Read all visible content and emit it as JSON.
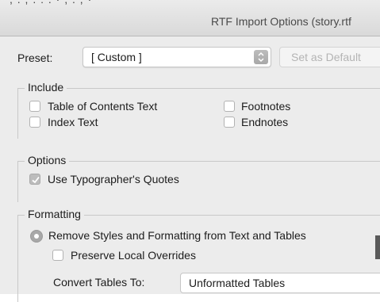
{
  "window": {
    "title": "RTF Import Options (story.rtf",
    "cut_text": ", . , . : . · , . , ·"
  },
  "preset": {
    "label": "Preset:",
    "value": "[ Custom ]",
    "set_default_label": "Set as Default",
    "set_default_enabled": false
  },
  "include": {
    "title": "Include",
    "items": [
      {
        "label": "Table of Contents Text",
        "checked": false
      },
      {
        "label": "Footnotes",
        "checked": false
      },
      {
        "label": "Index Text",
        "checked": false
      },
      {
        "label": "Endnotes",
        "checked": false
      }
    ]
  },
  "options": {
    "title": "Options",
    "typographers_quotes": {
      "label": "Use Typographer's Quotes",
      "checked": true
    }
  },
  "formatting": {
    "title": "Formatting",
    "remove_styles": {
      "label": "Remove Styles and Formatting from Text and Tables",
      "selected": true
    },
    "preserve_overrides": {
      "label": "Preserve Local Overrides",
      "checked": false
    },
    "convert_tables": {
      "label": "Convert Tables To:",
      "value": "Unformatted Tables"
    }
  },
  "colors": {
    "background": "#ececec",
    "checked_fill": "#bcbcbc",
    "disabled_text": "#b4b4b4"
  }
}
